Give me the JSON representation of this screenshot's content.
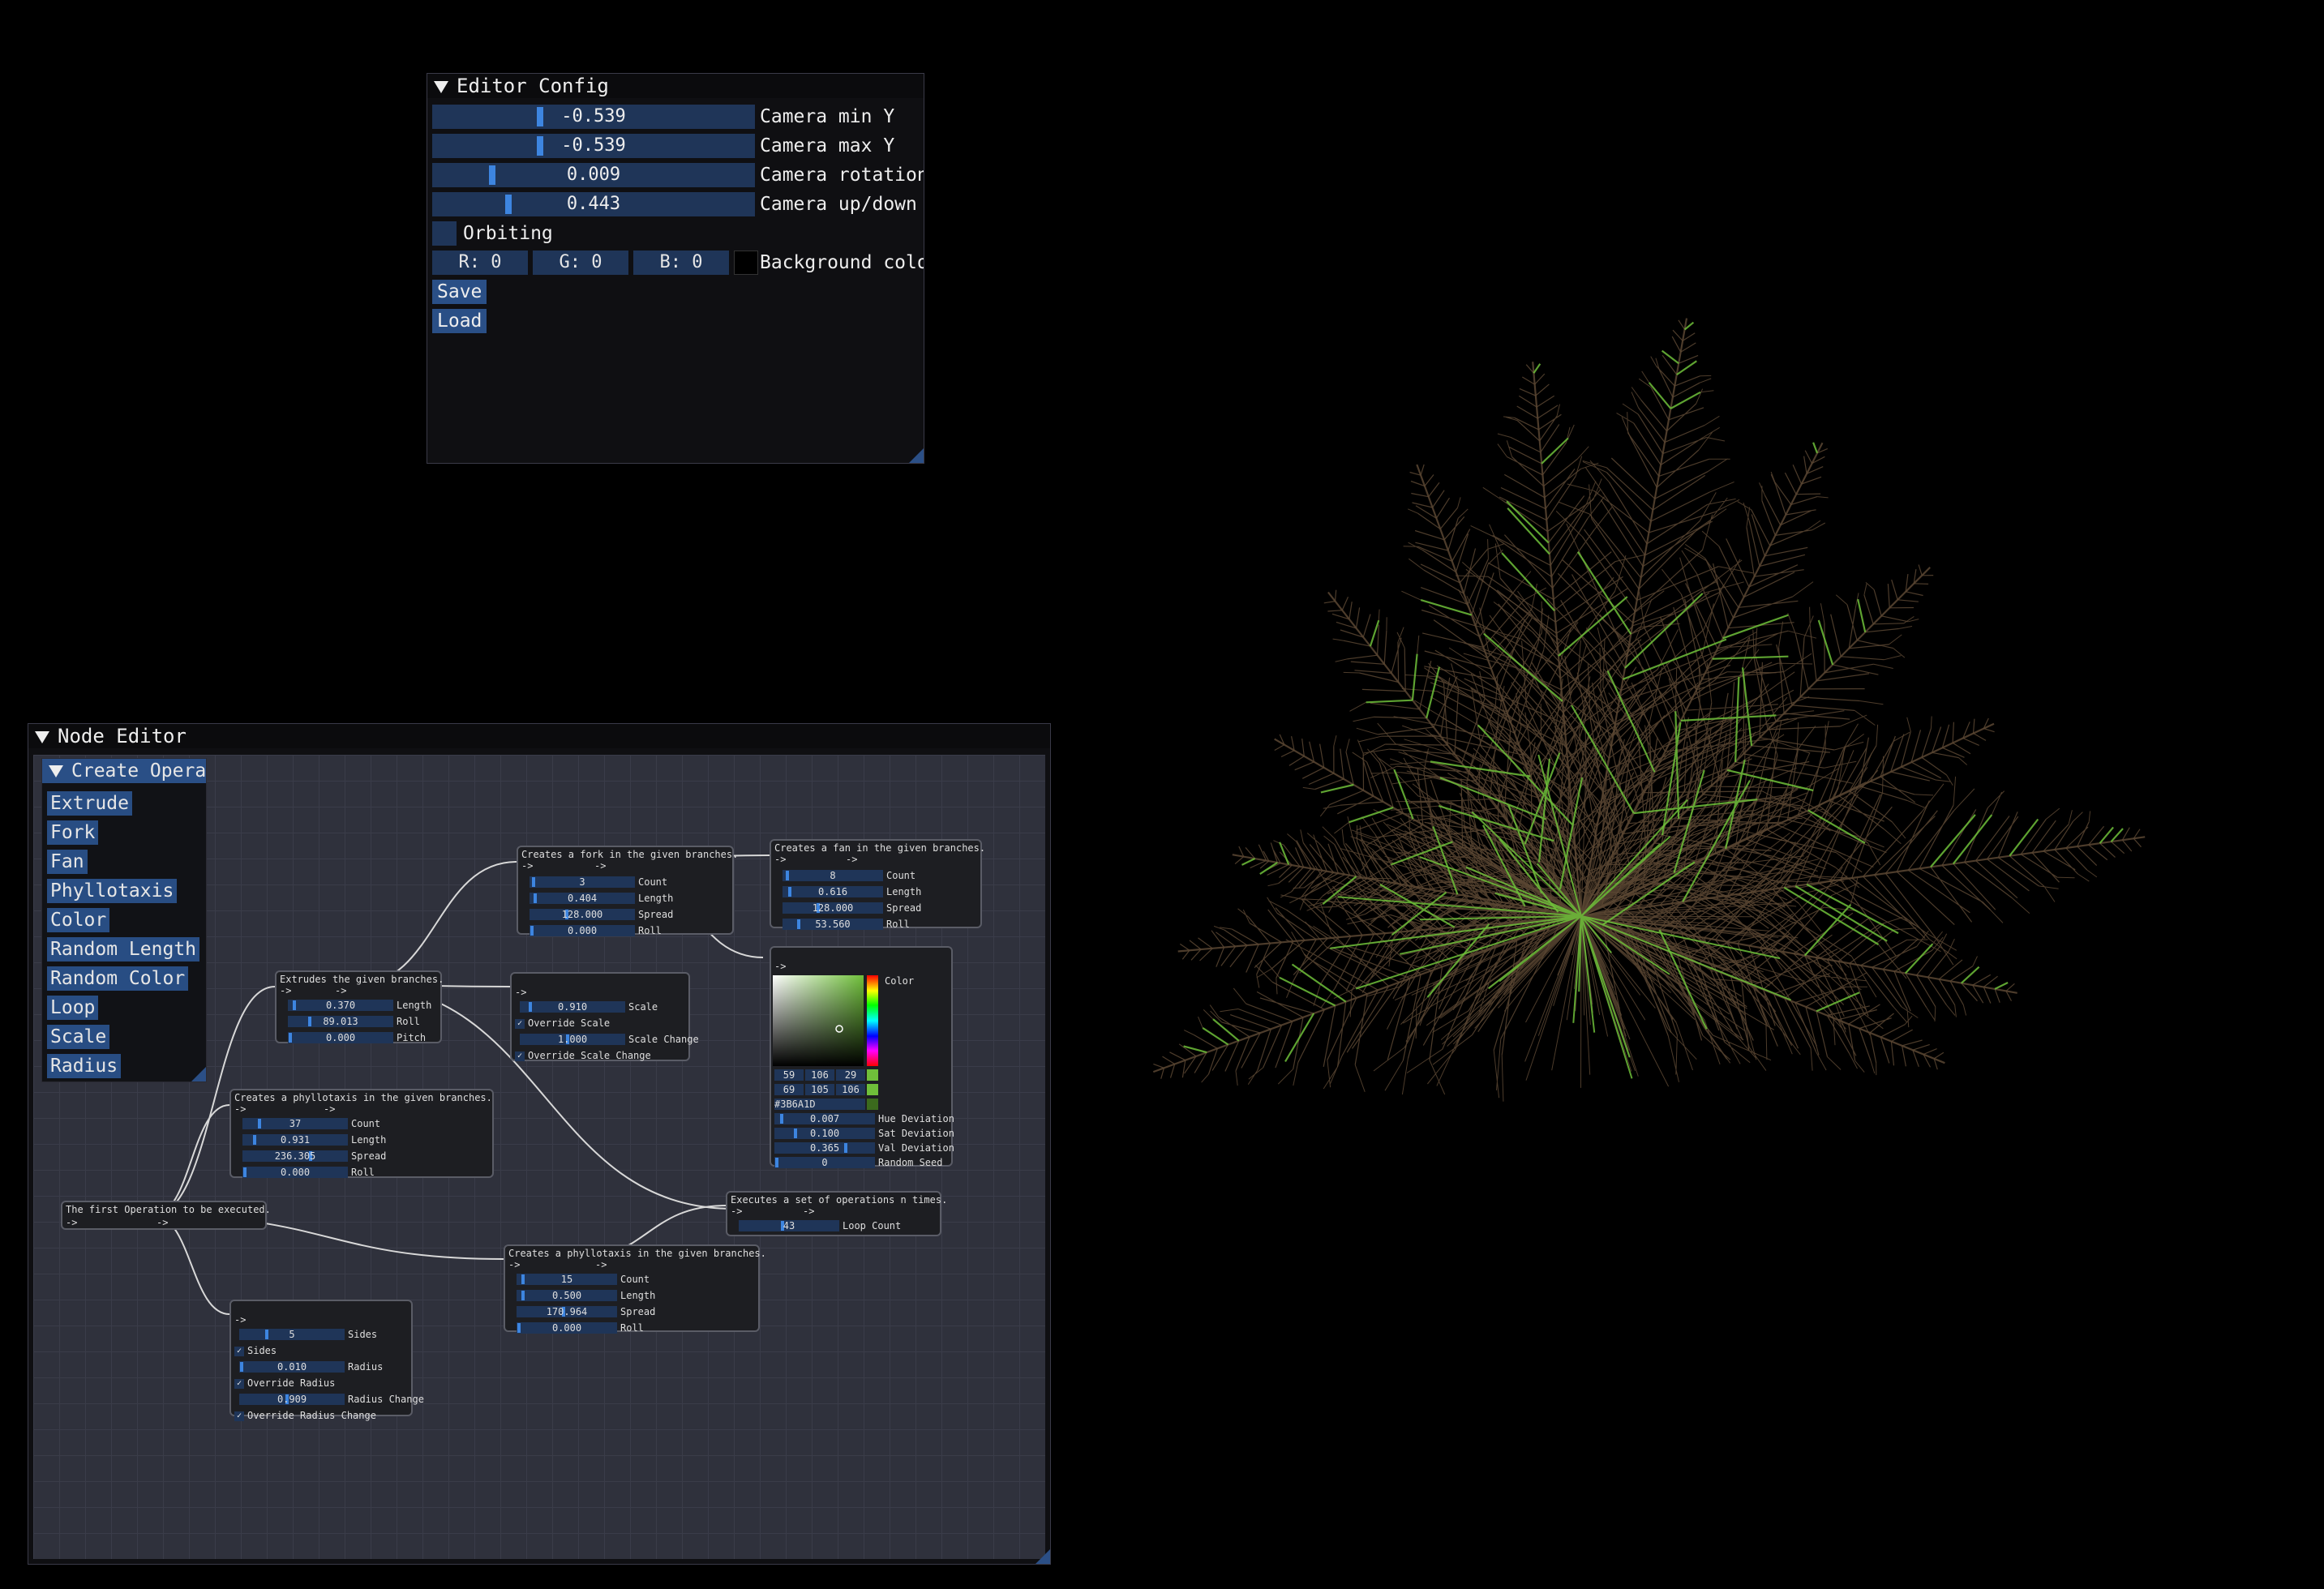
{
  "colors": {
    "branch": "#5a4632",
    "leaf_accent": "#6fbf3a",
    "window_bg": "#0f0f12",
    "slider_bg": "#1f3558",
    "grab": "#3d85e0",
    "button": "#2a4f86",
    "canvas": "#2f313c"
  },
  "editor_config": {
    "title": "Editor Config",
    "sliders": [
      {
        "value": "-0.539",
        "label": "Camera min Y",
        "fraction": 0.33
      },
      {
        "value": "-0.539",
        "label": "Camera max Y",
        "fraction": 0.33
      },
      {
        "value": "0.009",
        "label": "Camera rotation",
        "fraction": 0.18
      },
      {
        "value": "0.443",
        "label": "Camera up/down",
        "fraction": 0.23
      }
    ],
    "orbiting_label": "Orbiting",
    "bg": {
      "r": "R:  0",
      "g": "G:  0",
      "b": "B:  0",
      "label": "Background color"
    },
    "save_label": "Save",
    "load_label": "Load"
  },
  "node_editor": {
    "title": "Node Editor",
    "menu": {
      "header": "Create Operation",
      "items": [
        "Extrude",
        "Fork",
        "Fan",
        "Phyllotaxis",
        "Color",
        "Random Length",
        "Random Color",
        "Loop",
        "Scale",
        "Radius"
      ]
    },
    "pin_in": "->",
    "pin_out": "->",
    "nodes": {
      "root": {
        "desc": "The first Operation to be executed."
      },
      "extrude": {
        "desc": "Extrudes the given branches.",
        "fields": [
          {
            "v": "0.370",
            "l": "Length",
            "f": 0.05
          },
          {
            "v": "89.013",
            "l": "Roll",
            "f": 0.2
          },
          {
            "v": "0.000",
            "l": "Pitch",
            "f": 0.01
          }
        ]
      },
      "fork": {
        "desc": "Creates a fork in the given branches.",
        "fields": [
          {
            "v": "3",
            "l": "Count",
            "f": 0.02
          },
          {
            "v": "0.404",
            "l": "Length",
            "f": 0.04
          },
          {
            "v": "128.000",
            "l": "Spread",
            "f": 0.35
          },
          {
            "v": "0.000",
            "l": "Roll",
            "f": 0.01
          }
        ]
      },
      "fan": {
        "desc": "Creates a fan in the given branches.",
        "fields": [
          {
            "v": "8",
            "l": "Count",
            "f": 0.03
          },
          {
            "v": "0.616",
            "l": "Length",
            "f": 0.06
          },
          {
            "v": "128.000",
            "l": "Spread",
            "f": 0.35
          },
          {
            "v": "53.560",
            "l": "Roll",
            "f": 0.15
          }
        ]
      },
      "scale": {
        "fields": [
          {
            "v": "0.910",
            "l": "Scale",
            "f": 0.09
          }
        ],
        "check1": "Override Scale",
        "fields2": [
          {
            "v": "1.000",
            "l": "Scale Change",
            "f": 0.45
          }
        ],
        "check2": "Override Scale Change"
      },
      "color": {
        "label": "Color",
        "rgb1": [
          "59",
          "106",
          "29"
        ],
        "rgb2": [
          "69",
          "105",
          "106"
        ],
        "hex": "#3B6A1D",
        "fields": [
          {
            "v": "0.007",
            "l": "Hue Deviation",
            "f": 0.06
          },
          {
            "v": "0.100",
            "l": "Sat Deviation",
            "f": 0.2
          },
          {
            "v": "0.365",
            "l": "Val Deviation",
            "f": 0.72
          },
          {
            "v": "0",
            "l": "Random Seed",
            "f": 0.01
          }
        ]
      },
      "phyllo1": {
        "desc": "Creates a phyllotaxis in the given branches.",
        "fields": [
          {
            "v": "37",
            "l": "Count",
            "f": 0.15
          },
          {
            "v": "0.931",
            "l": "Length",
            "f": 0.1
          },
          {
            "v": "236.305",
            "l": "Spread",
            "f": 0.65
          },
          {
            "v": "0.000",
            "l": "Roll",
            "f": 0.01
          }
        ]
      },
      "loop": {
        "desc": "Executes a set of operations n times.",
        "fields": [
          {
            "v": "43",
            "l": "Loop Count",
            "f": 0.43
          }
        ]
      },
      "phyllo2": {
        "desc": "Creates a phyllotaxis in the given branches.",
        "fields": [
          {
            "v": "15",
            "l": "Count",
            "f": 0.05
          },
          {
            "v": "0.500",
            "l": "Length",
            "f": 0.05
          },
          {
            "v": "170.964",
            "l": "Spread",
            "f": 0.47
          },
          {
            "v": "0.000",
            "l": "Roll",
            "f": 0.01
          }
        ]
      },
      "radius": {
        "fields": [
          {
            "v": "5",
            "l": "Sides",
            "f": 0.25
          }
        ],
        "check1": "Sides",
        "fields2": [
          {
            "v": "0.010",
            "l": "Radius",
            "f": 0.01
          }
        ],
        "check2": "Override Radius",
        "fields3": [
          {
            "v": "0.909",
            "l": "Radius Change",
            "f": 0.45
          }
        ],
        "check3": "Override Radius Change"
      }
    }
  }
}
